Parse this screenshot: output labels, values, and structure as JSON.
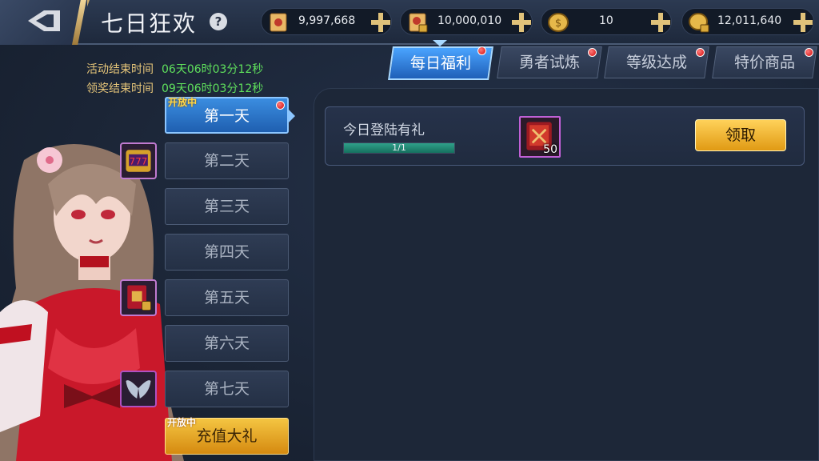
{
  "header": {
    "title": "七日狂欢",
    "help": "?"
  },
  "resources": [
    {
      "name": "scroll",
      "icon": "scroll-icon",
      "value": "9,997,668"
    },
    {
      "name": "locked-scroll",
      "icon": "locked-scroll-icon",
      "value": "10,000,010"
    },
    {
      "name": "coin",
      "icon": "coin-icon",
      "value": "10"
    },
    {
      "name": "locked-coin",
      "icon": "locked-coin-icon",
      "value": "12,011,640"
    }
  ],
  "timers": {
    "activity_label": "活动结束时间",
    "activity_value": "06天06时03分12秒",
    "claim_label": "领奖结束时间",
    "claim_value": "09天06时03分12秒"
  },
  "days": [
    {
      "label": "第一天",
      "tag": "开放中",
      "active": true
    },
    {
      "label": "第二天"
    },
    {
      "label": "第三天"
    },
    {
      "label": "第四天"
    },
    {
      "label": "第五天"
    },
    {
      "label": "第六天"
    },
    {
      "label": "第七天"
    }
  ],
  "charge": {
    "label": "充值大礼",
    "tag": "开放中"
  },
  "tabs": [
    {
      "label": "每日福利",
      "active": true
    },
    {
      "label": "勇者试炼"
    },
    {
      "label": "等级达成"
    },
    {
      "label": "特价商品"
    }
  ],
  "task": {
    "title": "今日登陆有礼",
    "progress_text": "1/1",
    "progress_fraction": 1.0,
    "item_icon": "red-scroll-item-icon",
    "item_count": "50",
    "claim_label": "领取"
  },
  "colors": {
    "accent_blue": "#3b8de0",
    "gold": "#f4c542",
    "timer_green": "#5fe05c",
    "timer_label": "#e8c77a"
  }
}
